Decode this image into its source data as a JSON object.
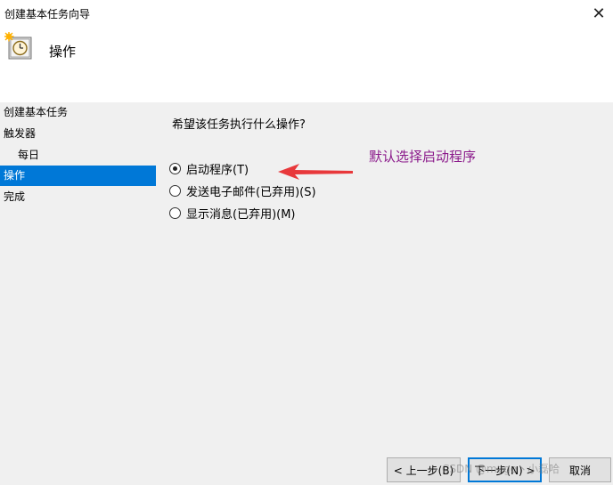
{
  "window": {
    "title": "创建基本任务向导",
    "close_icon": "close-icon",
    "app_icon": "task-scheduler-clock-icon"
  },
  "header": {
    "title": "操作"
  },
  "steps": [
    {
      "label": "创建基本任务"
    },
    {
      "label": "触发器"
    },
    {
      "label": "每日"
    },
    {
      "label": "操作",
      "active": true
    },
    {
      "label": "完成"
    }
  ],
  "content": {
    "question": "希望该任务执行什么操作?",
    "options": [
      {
        "label": "启动程序(T)",
        "checked": true
      },
      {
        "label": "发送电子邮件(已弃用)(S)",
        "checked": false
      },
      {
        "label": "显示消息(已弃用)(M)",
        "checked": false
      }
    ]
  },
  "annotation": {
    "text": "默认选择启动程序",
    "color": "#8b1a8b",
    "arrow_color": "#e8383b"
  },
  "buttons": {
    "back": "< 上一步(B)",
    "next": "下一步(N) >",
    "cancel": "取消"
  },
  "watermark": "CSDN @mage丶小磊哈"
}
